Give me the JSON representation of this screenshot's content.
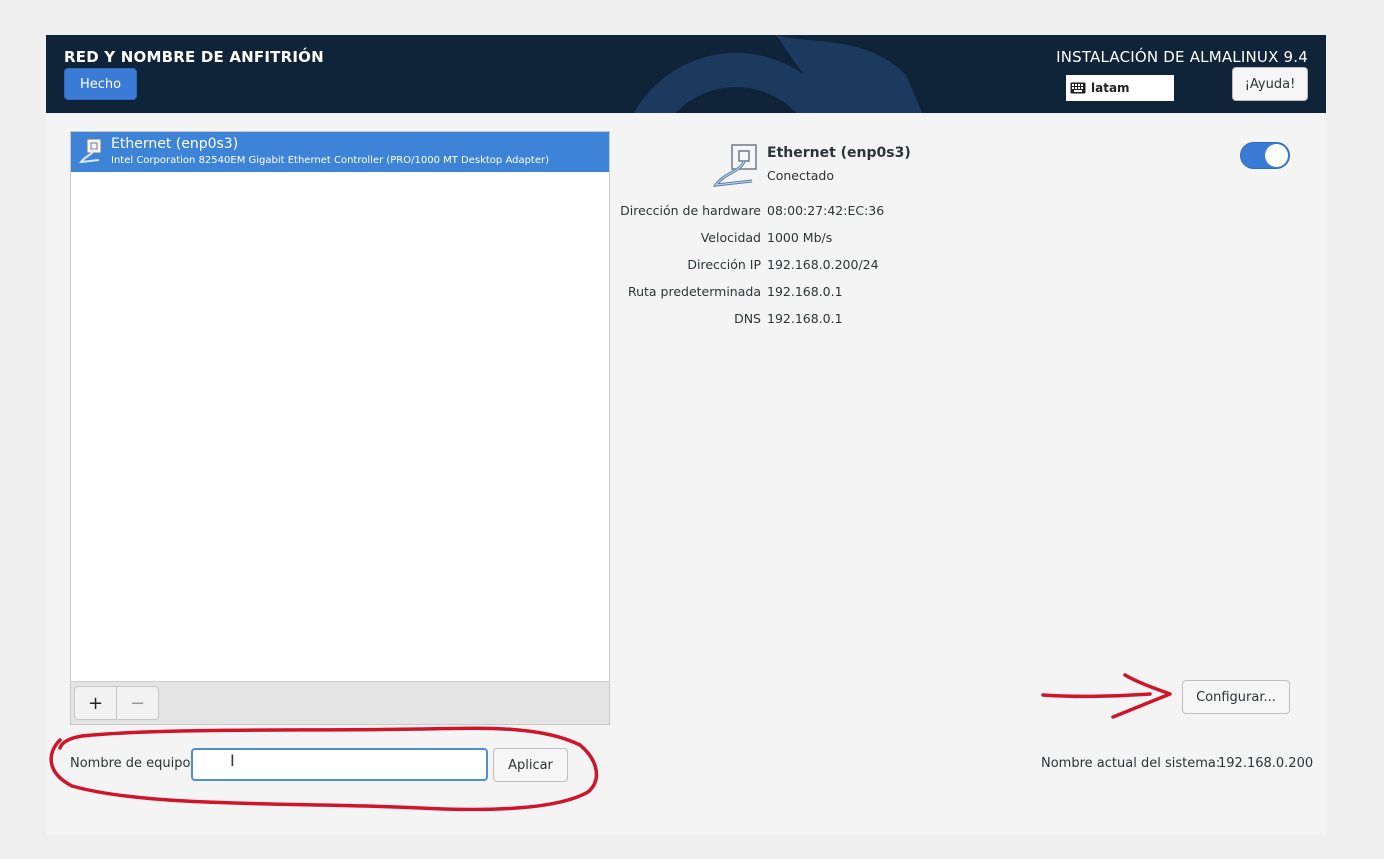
{
  "header": {
    "spoke_title": "RED Y NOMBRE DE ANFITRIÓN",
    "done_label": "Hecho",
    "product_title": "INSTALACIÓN DE ALMALINUX 9.4",
    "keyboard_layout": "latam",
    "help_label": "¡Ayuda!"
  },
  "device_list": {
    "items": [
      {
        "name": "Ethernet (enp0s3)",
        "description": "Intel Corporation 82540EM Gigabit Ethernet Controller (PRO/1000 MT Desktop Adapter)",
        "selected": true
      }
    ],
    "add_label": "+",
    "remove_label": "−"
  },
  "hostname": {
    "label": "Nombre de equipo:",
    "value": "",
    "apply_label": "Aplicar"
  },
  "detail": {
    "name": "Ethernet (enp0s3)",
    "status": "Conectado",
    "enabled": true,
    "properties": [
      {
        "label": "Dirección de hardware",
        "value": "08:00:27:42:EC:36"
      },
      {
        "label": "Velocidad",
        "value": "1000 Mb/s"
      },
      {
        "label": "Dirección IP",
        "value": "192.168.0.200/24"
      },
      {
        "label": "Ruta predeterminada",
        "value": "192.168.0.1"
      },
      {
        "label": "DNS",
        "value": "192.168.0.1"
      }
    ],
    "configure_label": "Configurar...",
    "current_hostname_label": "Nombre actual del sistema:",
    "current_hostname_value": "192.168.0.200"
  },
  "colors": {
    "header_bg": "#0f2339",
    "accent": "#3a7bd5",
    "annotation": "#d0142a"
  },
  "icons": [
    "keyboard-icon",
    "ethernet-icon",
    "plus-icon",
    "minus-icon"
  ]
}
